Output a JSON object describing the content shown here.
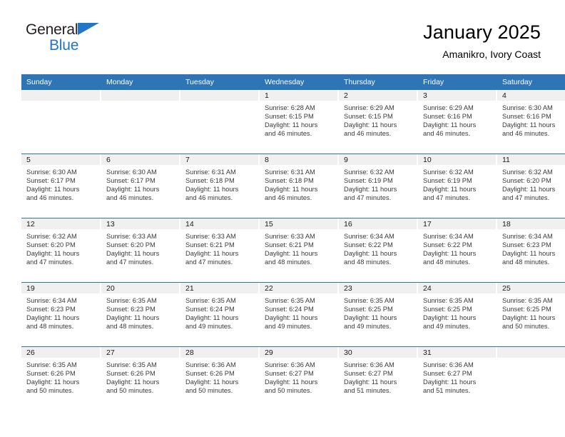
{
  "brand": {
    "line1": "General",
    "line2": "Blue",
    "flag_color": "#2176c7"
  },
  "header": {
    "title": "January 2025",
    "subtitle": "Amanikro, Ivory Coast"
  },
  "theme": {
    "header_blue": "#2e75b6",
    "daynum_band": "#f0f0f0",
    "text": "#3a3a3a"
  },
  "weekday_headers": [
    "Sunday",
    "Monday",
    "Tuesday",
    "Wednesday",
    "Thursday",
    "Friday",
    "Saturday"
  ],
  "weeks": [
    [
      {
        "day": "",
        "sunrise": "",
        "sunset": "",
        "daylight_l1": "",
        "daylight_l2": ""
      },
      {
        "day": "",
        "sunrise": "",
        "sunset": "",
        "daylight_l1": "",
        "daylight_l2": ""
      },
      {
        "day": "",
        "sunrise": "",
        "sunset": "",
        "daylight_l1": "",
        "daylight_l2": ""
      },
      {
        "day": "1",
        "sunrise": "Sunrise: 6:28 AM",
        "sunset": "Sunset: 6:15 PM",
        "daylight_l1": "Daylight: 11 hours",
        "daylight_l2": "and 46 minutes."
      },
      {
        "day": "2",
        "sunrise": "Sunrise: 6:29 AM",
        "sunset": "Sunset: 6:15 PM",
        "daylight_l1": "Daylight: 11 hours",
        "daylight_l2": "and 46 minutes."
      },
      {
        "day": "3",
        "sunrise": "Sunrise: 6:29 AM",
        "sunset": "Sunset: 6:16 PM",
        "daylight_l1": "Daylight: 11 hours",
        "daylight_l2": "and 46 minutes."
      },
      {
        "day": "4",
        "sunrise": "Sunrise: 6:30 AM",
        "sunset": "Sunset: 6:16 PM",
        "daylight_l1": "Daylight: 11 hours",
        "daylight_l2": "and 46 minutes."
      }
    ],
    [
      {
        "day": "5",
        "sunrise": "Sunrise: 6:30 AM",
        "sunset": "Sunset: 6:17 PM",
        "daylight_l1": "Daylight: 11 hours",
        "daylight_l2": "and 46 minutes."
      },
      {
        "day": "6",
        "sunrise": "Sunrise: 6:30 AM",
        "sunset": "Sunset: 6:17 PM",
        "daylight_l1": "Daylight: 11 hours",
        "daylight_l2": "and 46 minutes."
      },
      {
        "day": "7",
        "sunrise": "Sunrise: 6:31 AM",
        "sunset": "Sunset: 6:18 PM",
        "daylight_l1": "Daylight: 11 hours",
        "daylight_l2": "and 46 minutes."
      },
      {
        "day": "8",
        "sunrise": "Sunrise: 6:31 AM",
        "sunset": "Sunset: 6:18 PM",
        "daylight_l1": "Daylight: 11 hours",
        "daylight_l2": "and 46 minutes."
      },
      {
        "day": "9",
        "sunrise": "Sunrise: 6:32 AM",
        "sunset": "Sunset: 6:19 PM",
        "daylight_l1": "Daylight: 11 hours",
        "daylight_l2": "and 47 minutes."
      },
      {
        "day": "10",
        "sunrise": "Sunrise: 6:32 AM",
        "sunset": "Sunset: 6:19 PM",
        "daylight_l1": "Daylight: 11 hours",
        "daylight_l2": "and 47 minutes."
      },
      {
        "day": "11",
        "sunrise": "Sunrise: 6:32 AM",
        "sunset": "Sunset: 6:20 PM",
        "daylight_l1": "Daylight: 11 hours",
        "daylight_l2": "and 47 minutes."
      }
    ],
    [
      {
        "day": "12",
        "sunrise": "Sunrise: 6:32 AM",
        "sunset": "Sunset: 6:20 PM",
        "daylight_l1": "Daylight: 11 hours",
        "daylight_l2": "and 47 minutes."
      },
      {
        "day": "13",
        "sunrise": "Sunrise: 6:33 AM",
        "sunset": "Sunset: 6:20 PM",
        "daylight_l1": "Daylight: 11 hours",
        "daylight_l2": "and 47 minutes."
      },
      {
        "day": "14",
        "sunrise": "Sunrise: 6:33 AM",
        "sunset": "Sunset: 6:21 PM",
        "daylight_l1": "Daylight: 11 hours",
        "daylight_l2": "and 47 minutes."
      },
      {
        "day": "15",
        "sunrise": "Sunrise: 6:33 AM",
        "sunset": "Sunset: 6:21 PM",
        "daylight_l1": "Daylight: 11 hours",
        "daylight_l2": "and 48 minutes."
      },
      {
        "day": "16",
        "sunrise": "Sunrise: 6:34 AM",
        "sunset": "Sunset: 6:22 PM",
        "daylight_l1": "Daylight: 11 hours",
        "daylight_l2": "and 48 minutes."
      },
      {
        "day": "17",
        "sunrise": "Sunrise: 6:34 AM",
        "sunset": "Sunset: 6:22 PM",
        "daylight_l1": "Daylight: 11 hours",
        "daylight_l2": "and 48 minutes."
      },
      {
        "day": "18",
        "sunrise": "Sunrise: 6:34 AM",
        "sunset": "Sunset: 6:23 PM",
        "daylight_l1": "Daylight: 11 hours",
        "daylight_l2": "and 48 minutes."
      }
    ],
    [
      {
        "day": "19",
        "sunrise": "Sunrise: 6:34 AM",
        "sunset": "Sunset: 6:23 PM",
        "daylight_l1": "Daylight: 11 hours",
        "daylight_l2": "and 48 minutes."
      },
      {
        "day": "20",
        "sunrise": "Sunrise: 6:35 AM",
        "sunset": "Sunset: 6:23 PM",
        "daylight_l1": "Daylight: 11 hours",
        "daylight_l2": "and 48 minutes."
      },
      {
        "day": "21",
        "sunrise": "Sunrise: 6:35 AM",
        "sunset": "Sunset: 6:24 PM",
        "daylight_l1": "Daylight: 11 hours",
        "daylight_l2": "and 49 minutes."
      },
      {
        "day": "22",
        "sunrise": "Sunrise: 6:35 AM",
        "sunset": "Sunset: 6:24 PM",
        "daylight_l1": "Daylight: 11 hours",
        "daylight_l2": "and 49 minutes."
      },
      {
        "day": "23",
        "sunrise": "Sunrise: 6:35 AM",
        "sunset": "Sunset: 6:25 PM",
        "daylight_l1": "Daylight: 11 hours",
        "daylight_l2": "and 49 minutes."
      },
      {
        "day": "24",
        "sunrise": "Sunrise: 6:35 AM",
        "sunset": "Sunset: 6:25 PM",
        "daylight_l1": "Daylight: 11 hours",
        "daylight_l2": "and 49 minutes."
      },
      {
        "day": "25",
        "sunrise": "Sunrise: 6:35 AM",
        "sunset": "Sunset: 6:25 PM",
        "daylight_l1": "Daylight: 11 hours",
        "daylight_l2": "and 50 minutes."
      }
    ],
    [
      {
        "day": "26",
        "sunrise": "Sunrise: 6:35 AM",
        "sunset": "Sunset: 6:26 PM",
        "daylight_l1": "Daylight: 11 hours",
        "daylight_l2": "and 50 minutes."
      },
      {
        "day": "27",
        "sunrise": "Sunrise: 6:35 AM",
        "sunset": "Sunset: 6:26 PM",
        "daylight_l1": "Daylight: 11 hours",
        "daylight_l2": "and 50 minutes."
      },
      {
        "day": "28",
        "sunrise": "Sunrise: 6:36 AM",
        "sunset": "Sunset: 6:26 PM",
        "daylight_l1": "Daylight: 11 hours",
        "daylight_l2": "and 50 minutes."
      },
      {
        "day": "29",
        "sunrise": "Sunrise: 6:36 AM",
        "sunset": "Sunset: 6:27 PM",
        "daylight_l1": "Daylight: 11 hours",
        "daylight_l2": "and 50 minutes."
      },
      {
        "day": "30",
        "sunrise": "Sunrise: 6:36 AM",
        "sunset": "Sunset: 6:27 PM",
        "daylight_l1": "Daylight: 11 hours",
        "daylight_l2": "and 51 minutes."
      },
      {
        "day": "31",
        "sunrise": "Sunrise: 6:36 AM",
        "sunset": "Sunset: 6:27 PM",
        "daylight_l1": "Daylight: 11 hours",
        "daylight_l2": "and 51 minutes."
      },
      {
        "day": "",
        "sunrise": "",
        "sunset": "",
        "daylight_l1": "",
        "daylight_l2": ""
      }
    ]
  ]
}
